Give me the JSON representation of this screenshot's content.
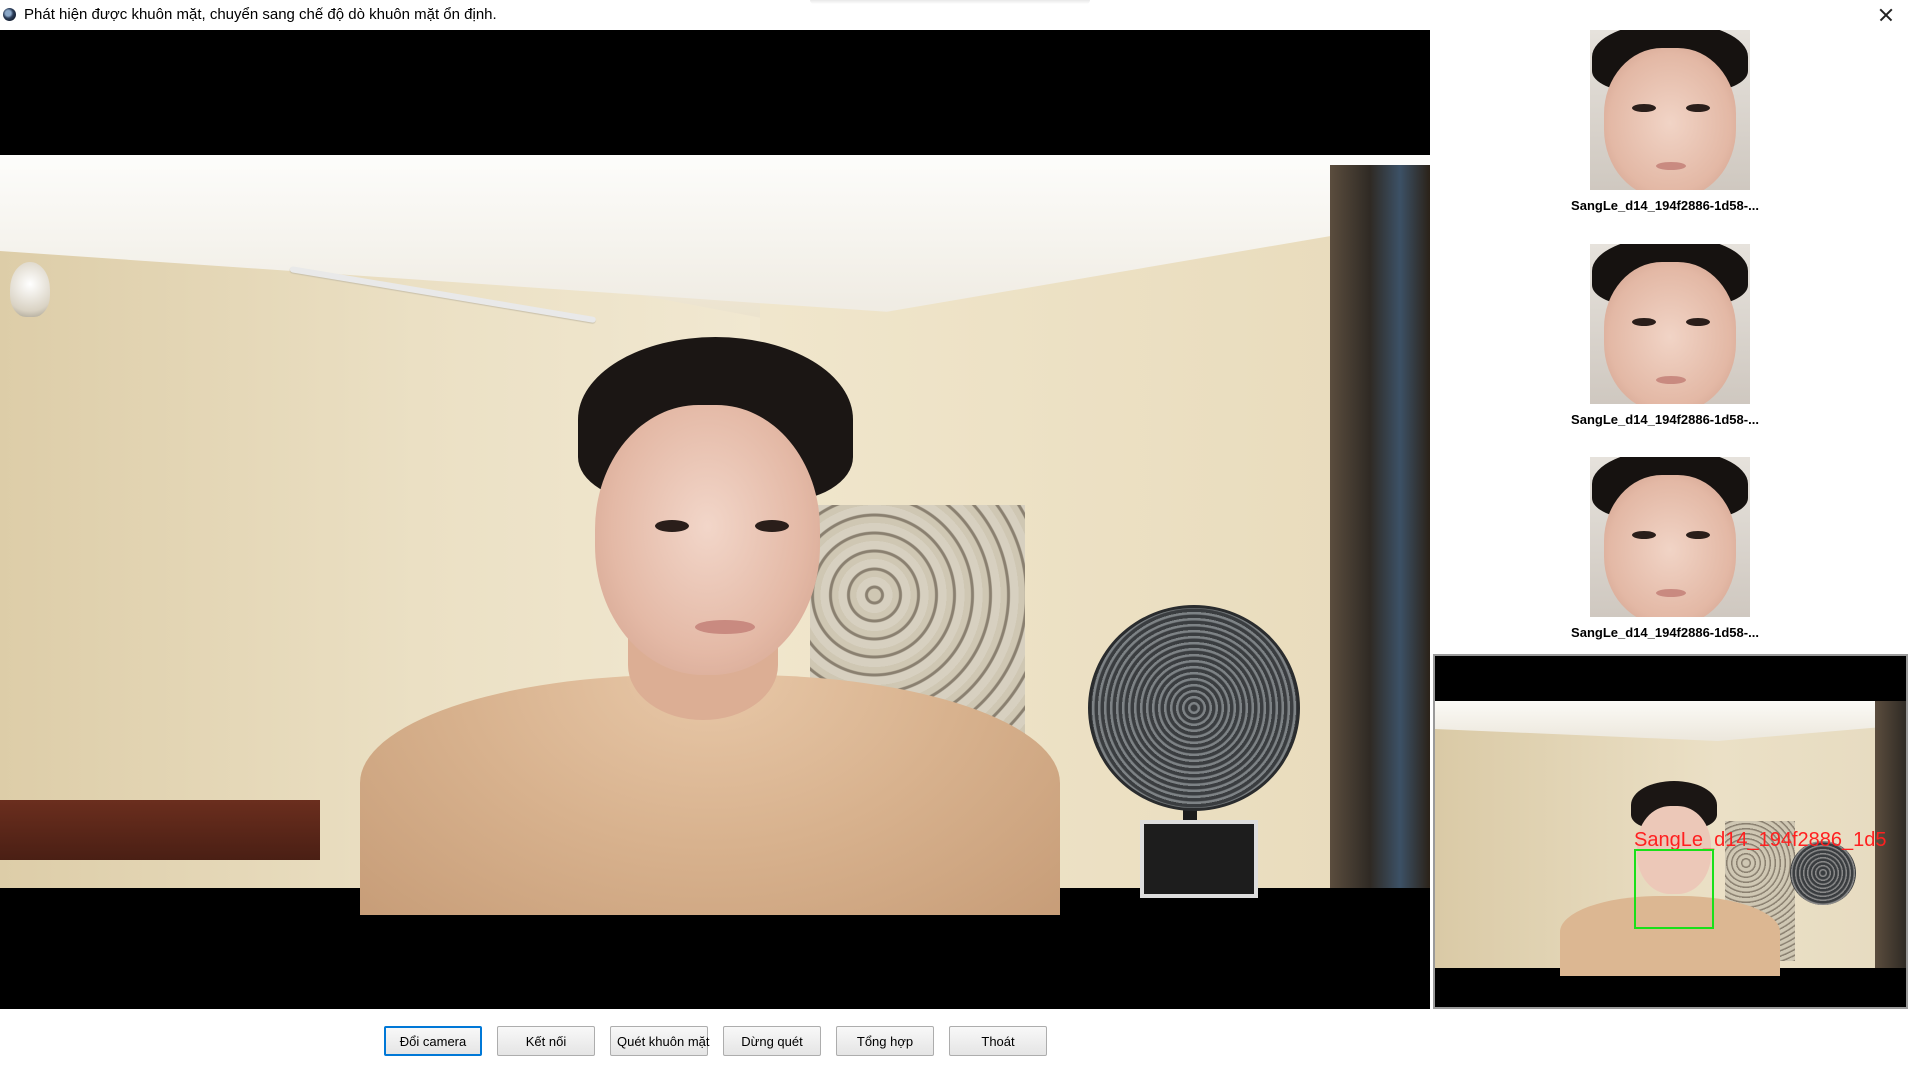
{
  "window": {
    "title": "Phát hiện được khuôn mặt, chuyển sang chế độ dò khuôn mặt ổn định.",
    "close_icon": "close-icon"
  },
  "captured_faces": [
    {
      "label": "SangLe_d14_194f2886-1d58-..."
    },
    {
      "label": "SangLe_d14_194f2886-1d58-..."
    },
    {
      "label": "SangLe_d14_194f2886-1d58-..."
    }
  ],
  "preview": {
    "detection_label": "SangLe_d14_194f2886_1d5",
    "detection_box_color": "#19e019",
    "detection_label_color": "#ff2020"
  },
  "toolbar": {
    "switch_camera": "Đổi camera",
    "connect": "Kết nối",
    "scan_face": "Quét khuôn mặt",
    "stop_scan": "Dừng quét",
    "summary": "Tổng hợp",
    "exit": "Thoát"
  }
}
